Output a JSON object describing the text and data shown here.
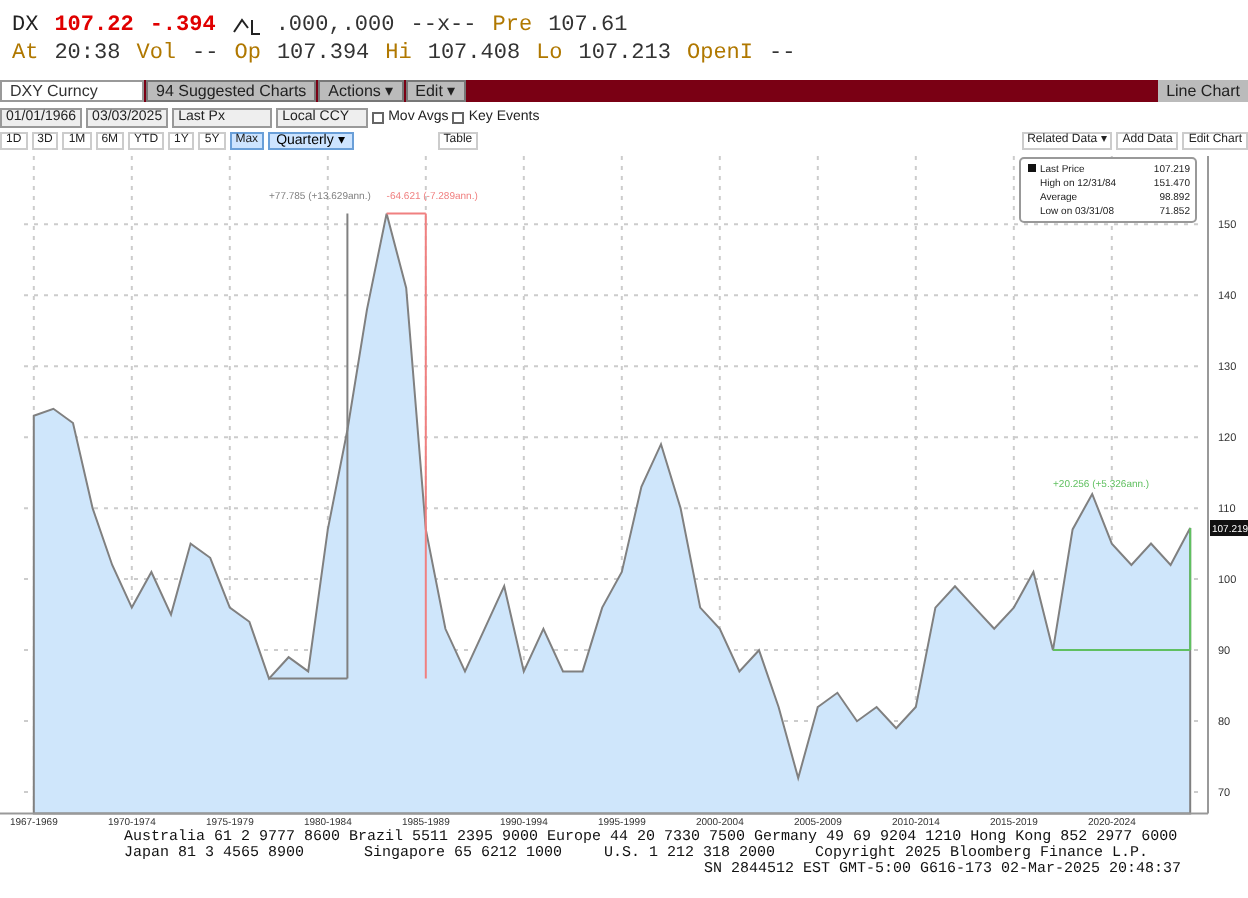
{
  "quote": {
    "ticker": "DX",
    "price": "107.22",
    "change": "-.394",
    "bid_ask": ".000,.000",
    "size": "--x--",
    "pre_label": "Pre",
    "pre_value": "107.61"
  },
  "quote_row2": [
    {
      "kind": "label",
      "text": "At"
    },
    {
      "kind": "value",
      "text": "20:38"
    },
    {
      "kind": "label",
      "text": "Vol"
    },
    {
      "kind": "value",
      "text": "--"
    },
    {
      "kind": "label",
      "text": "Op"
    },
    {
      "kind": "value",
      "text": "107.394"
    },
    {
      "kind": "label",
      "text": "Hi"
    },
    {
      "kind": "value",
      "text": "107.408"
    },
    {
      "kind": "label",
      "text": "Lo"
    },
    {
      "kind": "value",
      "text": "107.213"
    },
    {
      "kind": "label",
      "text": "OpenI"
    },
    {
      "kind": "value",
      "text": "--"
    }
  ],
  "toolbar": {
    "security": "DXY Curncy",
    "menus": [
      "94 Suggested Charts",
      "Actions ▾",
      "Edit ▾"
    ],
    "chart_type": "Line Chart"
  },
  "settings": {
    "start_date": "01/01/1966",
    "end_date": "03/03/2025",
    "field": "Last Px",
    "currency": "Local CCY",
    "options": [
      {
        "label": "Mov Avgs",
        "checked": false
      },
      {
        "label": "Key Events",
        "checked": false
      }
    ]
  },
  "ranges": [
    {
      "label": "1D",
      "selected": false
    },
    {
      "label": "3D",
      "selected": false
    },
    {
      "label": "1M",
      "selected": false
    },
    {
      "label": "6M",
      "selected": false
    },
    {
      "label": "YTD",
      "selected": false
    },
    {
      "label": "1Y",
      "selected": false
    },
    {
      "label": "5Y",
      "selected": false
    },
    {
      "label": "Max",
      "selected": true
    }
  ],
  "frequency": "Quarterly ▾",
  "table_button": "Table",
  "right_buttons": [
    "Related Data ▾",
    "Add Data",
    "Edit Chart"
  ],
  "legend_last_value": "107.219",
  "legend": [
    {
      "label": "High on 12/31/84",
      "value": "151.470"
    },
    {
      "label": "Average",
      "value": "98.892"
    },
    {
      "label": "Low on 03/31/08",
      "value": "71.852"
    }
  ],
  "last_price_label": "107.219",
  "chart_data": {
    "type": "area",
    "grid": true,
    "ylim": [
      67,
      159.6
    ],
    "yticks": [
      70,
      80,
      90,
      100,
      110,
      120,
      130,
      140,
      150
    ],
    "categories": [
      "1967-1969",
      null,
      null,
      null,
      null,
      "1970-1974",
      null,
      null,
      null,
      null,
      "1975-1979",
      null,
      null,
      null,
      null,
      "1980-1984",
      null,
      null,
      null,
      null,
      "1985-1989",
      null,
      null,
      null,
      null,
      "1990-1994",
      null,
      null,
      null,
      null,
      "1995-1999",
      null,
      null,
      null,
      null,
      "2000-2004",
      null,
      null,
      null,
      null,
      "2005-2009",
      null,
      null,
      null,
      null,
      "2010-2014",
      null,
      null,
      null,
      null,
      "2015-2019",
      null,
      null,
      null,
      null,
      "2020-2024",
      null,
      null,
      null,
      null
    ],
    "series": [
      {
        "name": "Last Price",
        "color": "#cfe6fb",
        "values": [
          123,
          124,
          122,
          110,
          102,
          96,
          101,
          95,
          105,
          103,
          96,
          94,
          86,
          89,
          87,
          107,
          121,
          138,
          151.5,
          141,
          107,
          93,
          87,
          93,
          99,
          87,
          93,
          87,
          87,
          96,
          101,
          113,
          119,
          110,
          96,
          93,
          87,
          90,
          82,
          72,
          82,
          84,
          80,
          82,
          79,
          82,
          96,
          99,
          96,
          93,
          96,
          101,
          90,
          107,
          112,
          105,
          102,
          105,
          102,
          107.2
        ]
      }
    ],
    "annotations": [
      "+77.785 (+13.629ann.)",
      "-64.621 (-7.289ann.)",
      "+20.256 (+5.326ann.)"
    ]
  },
  "footer": {
    "line1": "Australia 61 2 9777 8600 Brazil 5511 2395 9000 Europe 44 20 7330 7500 Germany 49 69 9204 1210 Hong Kong 852 2977 6000",
    "line2_left": "Japan 81 3 4565 8900",
    "line2_mid": "Singapore 65 6212 1000",
    "line2_us": "U.S. 1 212 318 2000",
    "copyright": "Copyright 2025 Bloomberg Finance L.P.",
    "session": "SN 2844512 EST  GMT-5:00 G616-173 02-Mar-2025 20:48:37"
  }
}
